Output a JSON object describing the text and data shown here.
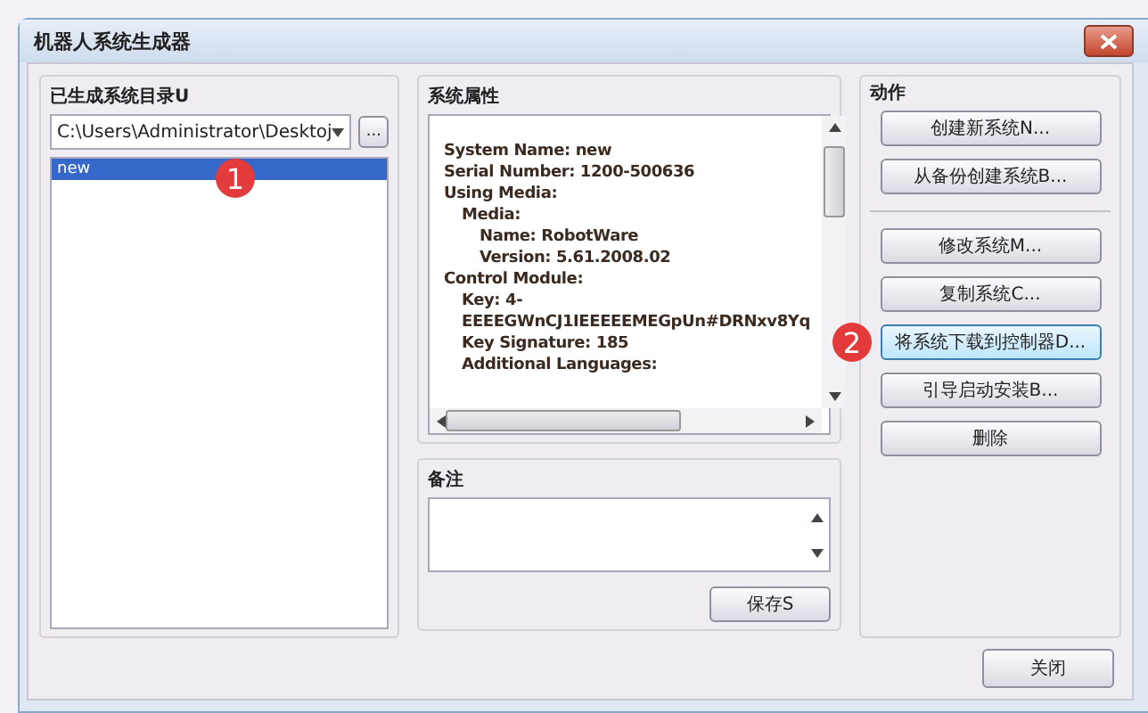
{
  "window": {
    "title": "机器人系统生成器"
  },
  "systems_panel": {
    "label": "已生成系统目录U",
    "path": "C:\\Users\\Administrator\\Desktoj",
    "browse_button": "...",
    "badge": "1",
    "items": [
      {
        "label": "new",
        "selected": true
      }
    ]
  },
  "properties_panel": {
    "label": "系统属性",
    "lines": [
      {
        "text": "System Name: new"
      },
      {
        "text": "Serial Number: 1200-500636"
      },
      {
        "text": "Using Media:",
        "children": [
          {
            "text": "Media:",
            "children": [
              {
                "text": "Name: RobotWare"
              },
              {
                "text": "Version: 5.61.2008.02"
              }
            ]
          }
        ]
      },
      {
        "text": "Control Module:",
        "children": [
          {
            "text": "Key: 4-"
          },
          {
            "text": "EEEEGWnCJ1IEEEEEMEGpUn#DRNxv8Yq"
          },
          {
            "text": "Key Signature: 185"
          },
          {
            "text": "Additional Languages:"
          }
        ]
      }
    ]
  },
  "notes_panel": {
    "label": "备注",
    "save_button": "保存S"
  },
  "actions_panel": {
    "label": "动作",
    "badge": "2",
    "groups": [
      [
        {
          "label": "创建新系统N...",
          "highlighted": false
        },
        {
          "label": "从备份创建系统B...",
          "highlighted": false
        }
      ],
      [
        {
          "label": "修改系统M...",
          "highlighted": false
        },
        {
          "label": "复制系统C...",
          "highlighted": false
        },
        {
          "label": "将系统下载到控制器D...",
          "highlighted": true
        },
        {
          "label": "引导启动安装B...",
          "highlighted": false
        },
        {
          "label": "删除",
          "highlighted": false
        }
      ]
    ]
  },
  "close_button": "关闭"
}
